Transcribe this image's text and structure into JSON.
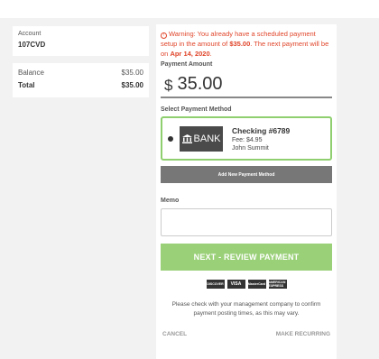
{
  "account": {
    "label": "Account",
    "value": "107CVD"
  },
  "balance": {
    "label": "Balance",
    "value": "$35.00",
    "total_label": "Total",
    "total_value": "$35.00"
  },
  "warning": {
    "icon": "warning-circle-icon",
    "prefix": "Warning: You already have a scheduled payment setup in the amount of ",
    "amount": "$35.00",
    "middle": ". The next payment will be on ",
    "date": "Apr 14, 2020",
    "suffix": "."
  },
  "payment_amount": {
    "label": "Payment Amount",
    "currency": "$",
    "value": "35.00"
  },
  "payment_method": {
    "label": "Select Payment Method",
    "badge": "BANK",
    "name": "Checking #6789",
    "fee": "Fee: $4.95",
    "holder": "John Summit",
    "selected": true,
    "accent": "#8fcf6f"
  },
  "add_method_label": "Add New Payment Method",
  "memo": {
    "label": "Memo",
    "value": ""
  },
  "next_button": {
    "label": "NEXT - REVIEW PAYMENT",
    "color": "#9ad078"
  },
  "card_logos": [
    "DISCOVER",
    "VISA",
    "MasterCard",
    "AMERICAN EXPRESS"
  ],
  "note": "Please check with your management company to confirm payment posting times, as this may vary.",
  "footer": {
    "cancel": "CANCEL",
    "recurring": "MAKE RECURRING"
  },
  "colors": {
    "warning": "#e0452a",
    "background": "#f2f2f2"
  }
}
